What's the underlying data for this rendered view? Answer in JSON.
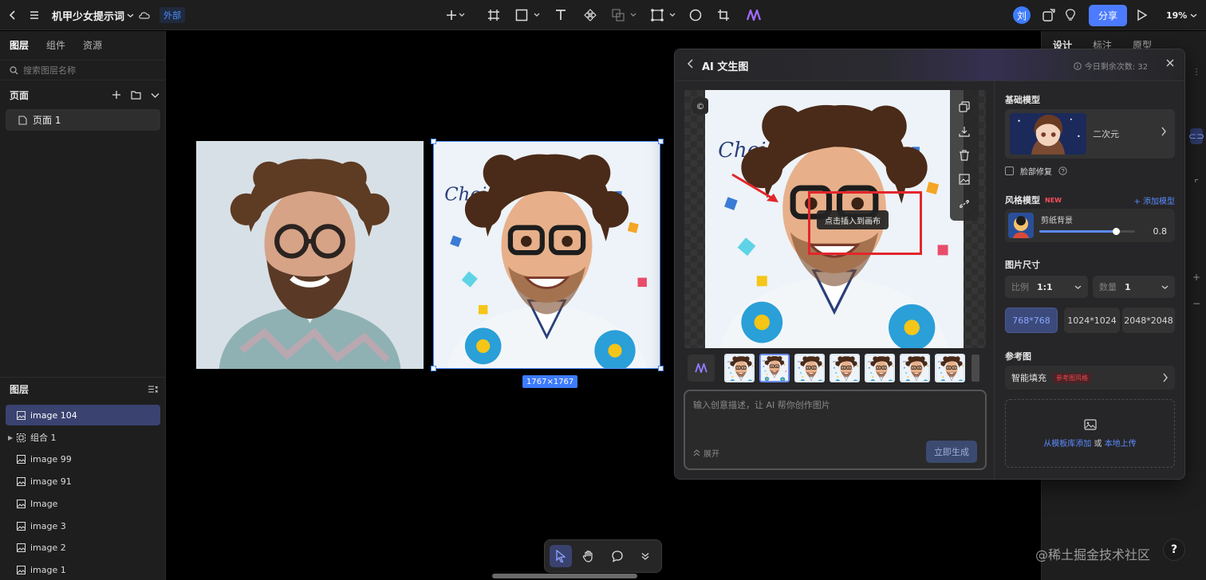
{
  "topbar": {
    "doc_title": "机甲少女提示词",
    "tag": "外部",
    "avatar": "刘",
    "share_label": "分享",
    "zoom": "19%"
  },
  "left_panel": {
    "tabs": [
      "图层",
      "组件",
      "资源"
    ],
    "search_placeholder": "搜索图层名称",
    "pages_label": "页面",
    "page_item": "页面 1",
    "layers_label": "图层",
    "layers": [
      "image 104",
      "组合 1",
      "image 99",
      "image 91",
      "Image",
      "image 3",
      "image 2",
      "image 1"
    ]
  },
  "right_panel": {
    "tabs": [
      "设计",
      "标注",
      "原型"
    ]
  },
  "canvas": {
    "size_badge": "1767×1767"
  },
  "ai_panel": {
    "title": "AI 文生图",
    "remaining": "今日剩余次数: 32",
    "tooltip": "点击插入到画布",
    "prompt_placeholder": "输入创意描述，让 AI 帮你创作图片",
    "expand_label": "展开",
    "generate_label": "立即生成",
    "base_model_label": "基础模型",
    "base_model_name": "二次元",
    "face_fix_label": "脸部修复",
    "style_model_label": "风格模型",
    "new_tag": "NEW",
    "add_model_label": "+ 添加模型",
    "style_name": "剪纸背景",
    "style_weight": "0.8",
    "style_weight_value": 0.8,
    "image_size_label": "图片尺寸",
    "ratio_key": "比例",
    "ratio_value": "1:1",
    "count_key": "数量",
    "count_value": "1",
    "sizes": [
      "768*768",
      "1024*1024",
      "2048*2048"
    ],
    "ref_label": "参考图",
    "smart_fill_label": "智能填充",
    "smart_fill_tag": "参考图风格",
    "upload_from_lib": "从模板库添加",
    "upload_or": "或",
    "upload_local": "本地上传"
  },
  "watermark": "@稀土掘金技术社区",
  "help": "?"
}
